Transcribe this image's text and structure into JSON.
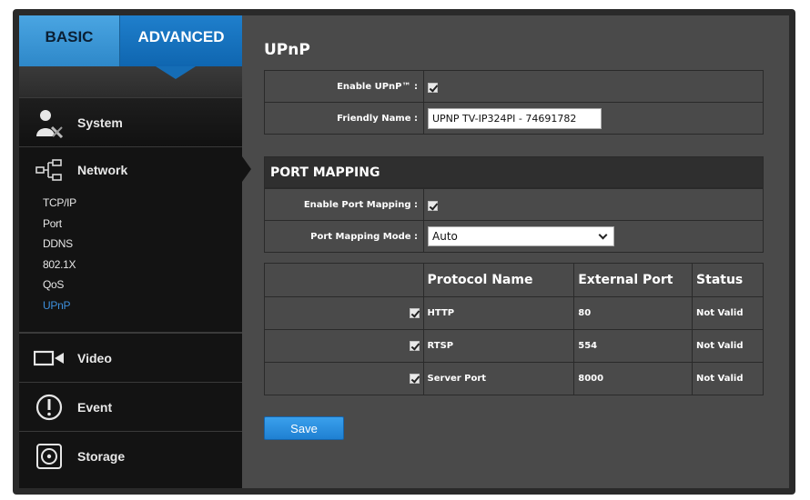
{
  "tabs": {
    "basic": "BASIC",
    "advanced": "ADVANCED"
  },
  "sidebar": {
    "system": "System",
    "network": "Network",
    "network_items": [
      {
        "label": "TCP/IP"
      },
      {
        "label": "Port"
      },
      {
        "label": "DDNS"
      },
      {
        "label": "802.1X"
      },
      {
        "label": "QoS"
      },
      {
        "label": "UPnP",
        "active": true
      }
    ],
    "video": "Video",
    "event": "Event",
    "storage": "Storage"
  },
  "page": {
    "title": "UPnP",
    "enable_upnp_label": "Enable UPnP™ :",
    "enable_upnp_checked": true,
    "friendly_name_label": "Friendly Name :",
    "friendly_name_value": "UPNP TV-IP324PI - 74691782",
    "port_mapping_section": "PORT MAPPING",
    "enable_port_mapping_label": "Enable Port Mapping :",
    "enable_port_mapping_checked": true,
    "port_mapping_mode_label": "Port Mapping Mode :",
    "port_mapping_mode_value": "Auto",
    "save_label": "Save"
  },
  "port_table": {
    "headers": [
      "",
      "Protocol Name",
      "External Port",
      "Status"
    ],
    "rows": [
      {
        "checked": true,
        "protocol": "HTTP",
        "port": "80",
        "status": "Not Valid"
      },
      {
        "checked": true,
        "protocol": "RTSP",
        "port": "554",
        "status": "Not Valid"
      },
      {
        "checked": true,
        "protocol": "Server Port",
        "port": "8000",
        "status": "Not Valid"
      }
    ]
  },
  "colors": {
    "accent": "#1f80d2",
    "active_sub": "#3d8fdc",
    "panel": "#4a4a4a",
    "sidebar": "#131313"
  }
}
